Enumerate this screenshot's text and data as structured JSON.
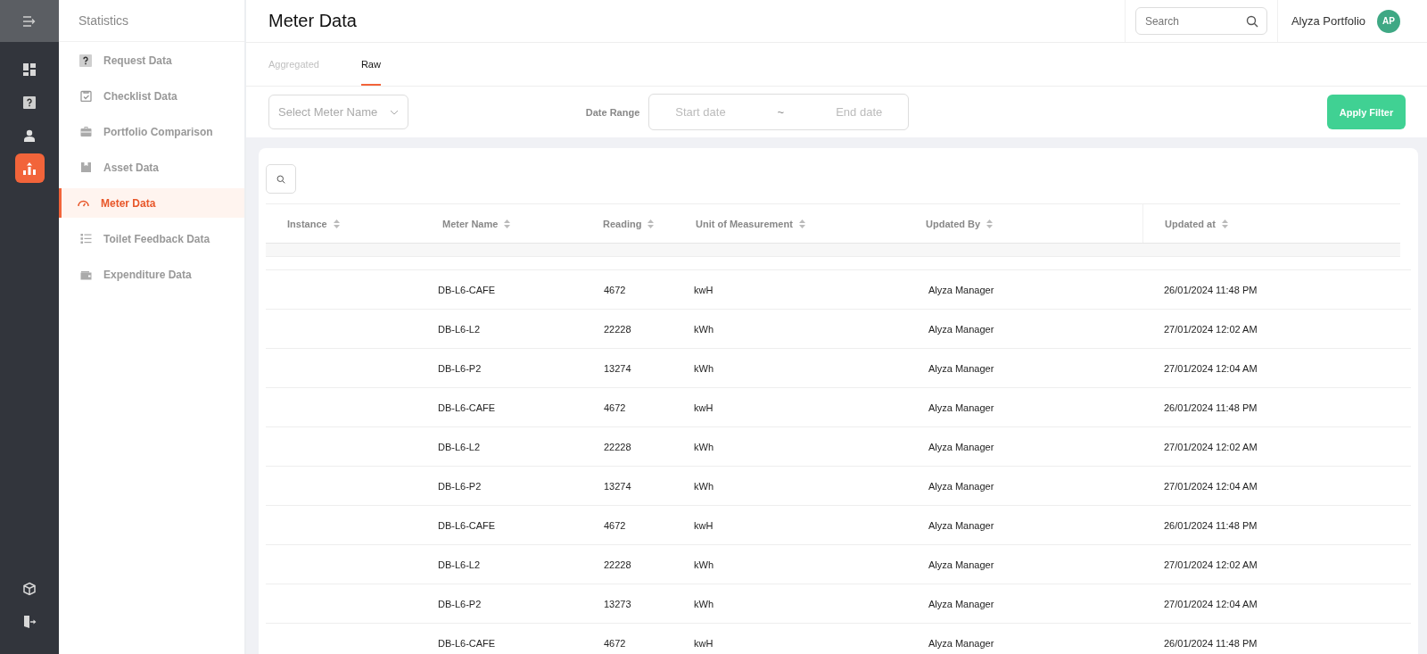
{
  "rail": {
    "items": [
      {
        "kind": "dashboard",
        "selected": false
      },
      {
        "kind": "question",
        "selected": false
      },
      {
        "kind": "person",
        "selected": false
      },
      {
        "kind": "chart",
        "selected": true
      }
    ],
    "bottom_items": [
      {
        "kind": "cube"
      },
      {
        "kind": "logout"
      }
    ]
  },
  "sidebar": {
    "title": "Statistics",
    "items": [
      {
        "kind": "question",
        "label": "Request Data",
        "selected": false
      },
      {
        "kind": "checklist",
        "label": "Checklist Data",
        "selected": false
      },
      {
        "kind": "briefcase",
        "label": "Portfolio Comparison",
        "selected": false
      },
      {
        "kind": "box",
        "label": "Asset Data",
        "selected": false
      },
      {
        "kind": "gauge",
        "label": "Meter Data",
        "selected": true
      },
      {
        "kind": "list",
        "label": "Toilet Feedback Data",
        "selected": false
      },
      {
        "kind": "wallet",
        "label": "Expenditure Data",
        "selected": false
      }
    ]
  },
  "header": {
    "title": "Meter Data",
    "search": {
      "placeholder": "Search"
    },
    "user": {
      "name": "Alyza Portfolio",
      "initials": "AP",
      "color": "#3fa884"
    }
  },
  "tabs": [
    {
      "label": "Aggregated",
      "selected": false
    },
    {
      "label": "Raw",
      "selected": true
    }
  ],
  "filters": {
    "meter_select": {
      "placeholder": "Select Meter Name"
    },
    "date_range": {
      "label": "Date Range",
      "start_placeholder": "Start date",
      "separator": "~",
      "end_placeholder": "End date"
    },
    "apply_button": "Apply Filter"
  },
  "table": {
    "columns": [
      "Instance",
      "Meter Name",
      "Reading",
      "Unit of Measurement",
      "Updated By",
      "Updated at"
    ],
    "rows": [
      [
        "",
        "DB-L6-CAFE",
        "4672",
        "kwH",
        "Alyza Manager",
        "26/01/2024 11:48 PM"
      ],
      [
        "",
        "DB-L6-L2",
        "22228",
        "kWh",
        "Alyza Manager",
        "27/01/2024 12:02 AM"
      ],
      [
        "",
        "DB-L6-P2",
        "13274",
        "kWh",
        "Alyza Manager",
        "27/01/2024 12:04 AM"
      ],
      [
        "",
        "DB-L6-CAFE",
        "4672",
        "kwH",
        "Alyza Manager",
        "26/01/2024 11:48 PM"
      ],
      [
        "",
        "DB-L6-L2",
        "22228",
        "kWh",
        "Alyza Manager",
        "27/01/2024 12:02 AM"
      ],
      [
        "",
        "DB-L6-P2",
        "13274",
        "kWh",
        "Alyza Manager",
        "27/01/2024 12:04 AM"
      ],
      [
        "",
        "DB-L6-CAFE",
        "4672",
        "kwH",
        "Alyza Manager",
        "26/01/2024 11:48 PM"
      ],
      [
        "",
        "DB-L6-L2",
        "22228",
        "kWh",
        "Alyza Manager",
        "27/01/2024 12:02 AM"
      ],
      [
        "",
        "DB-L6-P2",
        "13273",
        "kWh",
        "Alyza Manager",
        "27/01/2024 12:04 AM"
      ],
      [
        "",
        "DB-L6-CAFE",
        "4672",
        "kwH",
        "Alyza Manager",
        "26/01/2024 11:48 PM"
      ]
    ]
  }
}
